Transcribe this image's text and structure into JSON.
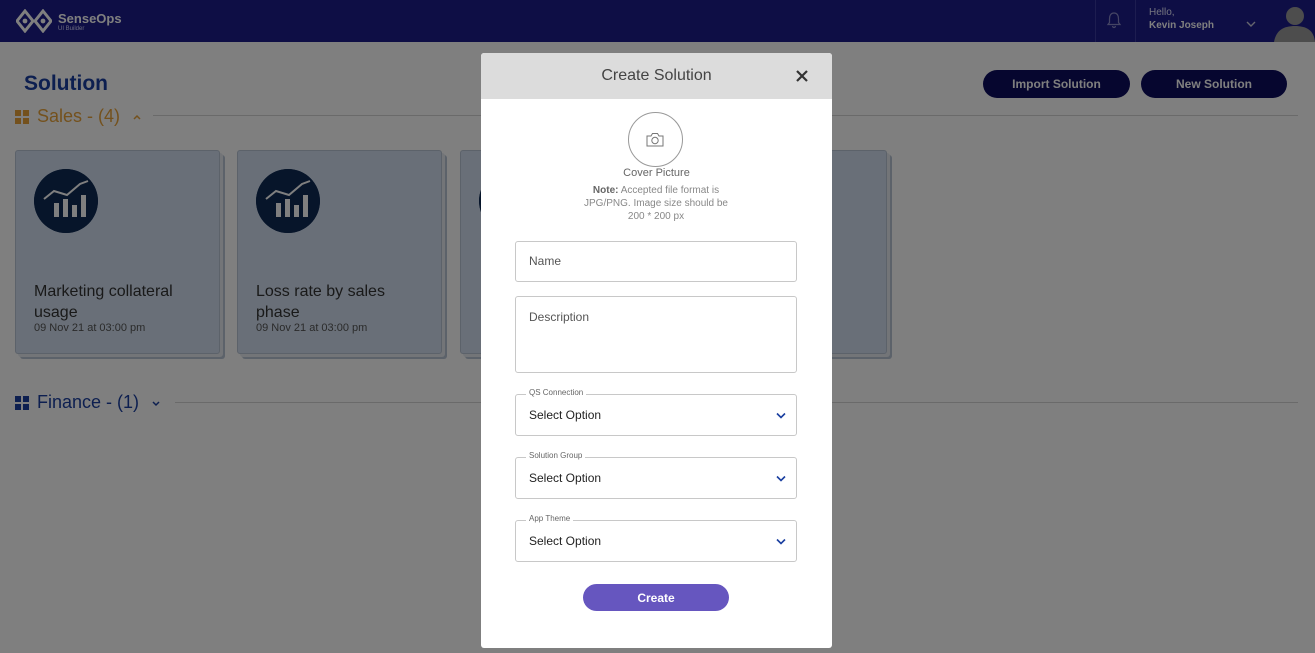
{
  "header": {
    "brand_name": "SenseOps",
    "brand_sub": "UI Builder",
    "greeting": "Hello,",
    "user_name": "Kevin Joseph"
  },
  "page": {
    "title": "Solution",
    "import_label": "Import Solution",
    "new_label": "New Solution"
  },
  "groups": [
    {
      "label": "Sales - (4)",
      "color": "#e8a33a",
      "expanded": true
    },
    {
      "label": "Finance - (1)",
      "color": "#1a3fa0",
      "expanded": false
    }
  ],
  "cards": [
    {
      "title": "Marketing collateral usage",
      "date": "09 Nov 21 at 03:00 pm",
      "icon": "chart-icon"
    },
    {
      "title": "Loss rate by sales phase",
      "date": "09 Nov 21 at 03:00 pm",
      "icon": "chart-icon"
    },
    {
      "title": "",
      "date": "",
      "icon": "chart-icon"
    },
    {
      "title": "",
      "date": "",
      "icon": "chart-icon"
    }
  ],
  "modal": {
    "title": "Create Solution",
    "cover_label": "Cover Picture",
    "note_bold": "Note:",
    "note_text": " Accepted file format is JPG/PNG. Image size should be 200 * 200 px",
    "name_placeholder": "Name",
    "description_placeholder": "Description",
    "selects": [
      {
        "label": "QS Connection",
        "value": "Select Option"
      },
      {
        "label": "Solution Group",
        "value": "Select Option"
      },
      {
        "label": "App Theme",
        "value": "Select Option"
      }
    ],
    "create_label": "Create"
  },
  "colors": {
    "header_bg": "#1c1c8a",
    "title_blue": "#1a3fa0",
    "dark_button": "#0c0c5e",
    "create_button": "#6656bf",
    "card_bg": "#d2dff0",
    "icon_bg": "#0f2a55"
  }
}
